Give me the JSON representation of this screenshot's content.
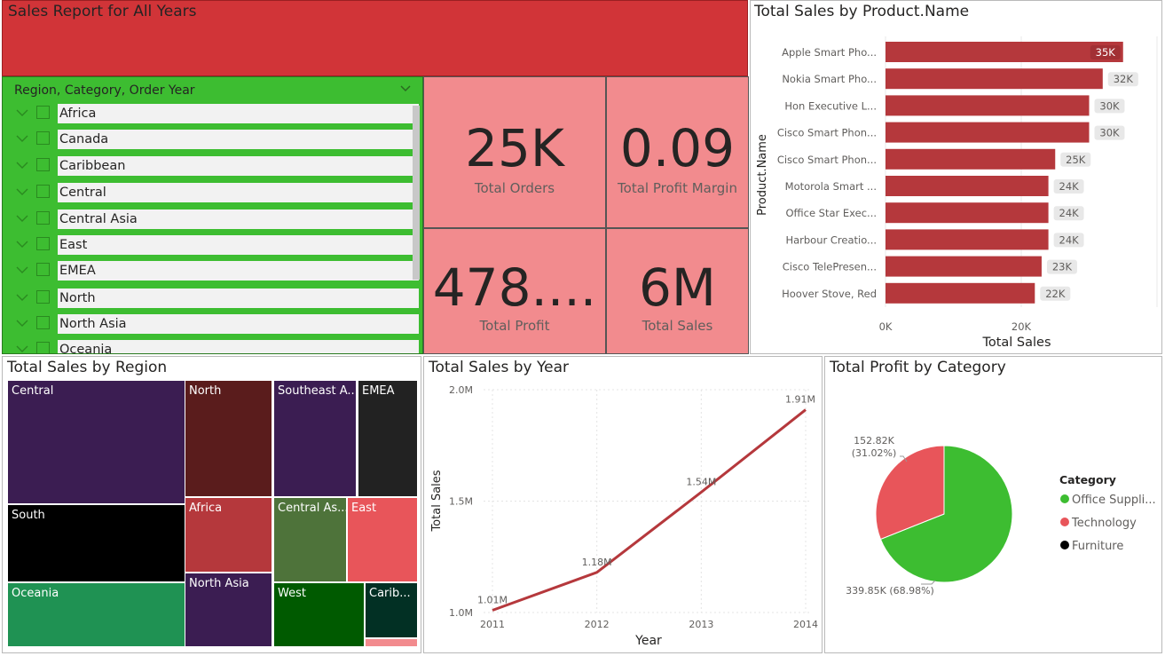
{
  "header": {
    "title": "Sales Report for All Years"
  },
  "slicer": {
    "title": "Region, Category, Order Year",
    "items": [
      {
        "label": "Africa"
      },
      {
        "label": "Canada"
      },
      {
        "label": "Caribbean"
      },
      {
        "label": "Central"
      },
      {
        "label": "Central Asia"
      },
      {
        "label": "East"
      },
      {
        "label": "EMEA"
      },
      {
        "label": "North"
      },
      {
        "label": "North Asia"
      },
      {
        "label": "Oceania"
      }
    ]
  },
  "cards": {
    "total_orders": {
      "value": "25K",
      "label": "Total Orders"
    },
    "total_profit_margin": {
      "value": "0.09",
      "label": "Total Profit Margin"
    },
    "total_profit": {
      "value": "478....",
      "label": "Total Profit"
    },
    "total_sales": {
      "value": "6M",
      "label": "Total Sales"
    }
  },
  "colors": {
    "banner": "#d13438",
    "slicer_bg": "#3dbd31",
    "card_bg": "#f28b8e",
    "bar": "#b5383c",
    "line": "#b5383c"
  },
  "bar_chart": {
    "title": "Total Sales by Product.Name",
    "xlabel": "Total Sales",
    "ylabel": "Product.Name",
    "ticks": [
      "0K",
      "20K"
    ],
    "chart_data": {
      "type": "bar",
      "orientation": "horizontal",
      "categories": [
        "Apple Smart Pho...",
        "Nokia Smart Pho...",
        "Hon Executive L...",
        "Cisco Smart Phon...",
        "Cisco Smart Phon...",
        "Motorola Smart ...",
        "Office Star Exec...",
        "Harbour Creatio...",
        "Cisco TelePresen...",
        "Hoover Stove, Red"
      ],
      "values": [
        35000,
        32000,
        30000,
        30000,
        25000,
        24000,
        24000,
        24000,
        23000,
        22000
      ],
      "data_labels": [
        "35K",
        "32K",
        "30K",
        "30K",
        "25K",
        "24K",
        "24K",
        "24K",
        "23K",
        "22K"
      ],
      "xlim": [
        0,
        40000
      ],
      "xlabel": "Total Sales",
      "ylabel": "Product.Name"
    }
  },
  "treemap": {
    "title": "Total Sales by Region",
    "chart_data": {
      "type": "treemap",
      "items": [
        {
          "label": "Central",
          "color": "#3b1d52"
        },
        {
          "label": "South",
          "color": "#000000"
        },
        {
          "label": "Oceania",
          "color": "#1f9253"
        },
        {
          "label": "North",
          "color": "#5a1c1c"
        },
        {
          "label": "Southeast A...",
          "color": "#3b1d52"
        },
        {
          "label": "EMEA",
          "color": "#222222"
        },
        {
          "label": "Africa",
          "color": "#b5383c"
        },
        {
          "label": "Central As...",
          "color": "#4e733a"
        },
        {
          "label": "East",
          "color": "#e8555a"
        },
        {
          "label": "North Asia",
          "color": "#3b1d52"
        },
        {
          "label": "West",
          "color": "#005a00"
        },
        {
          "label": "Carib...",
          "color": "#023024"
        },
        {
          "label": "",
          "color": "#f28b8e"
        }
      ]
    }
  },
  "line_chart": {
    "title": "Total Sales by Year",
    "xlabel": "Year",
    "ylabel": "Total Sales",
    "yticks": [
      "2.0M",
      "1.5M",
      "1.0M"
    ],
    "chart_data": {
      "type": "line",
      "x": [
        2011,
        2012,
        2013,
        2014
      ],
      "y": [
        1.01,
        1.18,
        1.54,
        1.91
      ],
      "data_labels": [
        "1.01M",
        "1.18M",
        "1.54M",
        "1.91M"
      ],
      "ylim": [
        1.0,
        2.0
      ],
      "y_unit": "M",
      "xlabel": "Year",
      "ylabel": "Total Sales",
      "grid": true
    }
  },
  "pie_chart": {
    "title": "Total Profit by Category",
    "legend_title": "Category",
    "legend": [
      {
        "label": "Office Suppli...",
        "color": "#3dbd31"
      },
      {
        "label": "Technology",
        "color": "#e8555a"
      },
      {
        "label": "Furniture",
        "color": "#000000"
      }
    ],
    "chart_data": {
      "type": "pie",
      "labels": [
        "Office Supplies",
        "Technology"
      ],
      "values": [
        339.85,
        152.82
      ],
      "percents": [
        68.98,
        31.02
      ],
      "data_labels": [
        [
          "339.85K (68.98%)"
        ],
        [
          "152.82K",
          "(31.02%)"
        ]
      ],
      "colors": [
        "#3dbd31",
        "#e8555a"
      ],
      "legend_position": "right"
    }
  }
}
